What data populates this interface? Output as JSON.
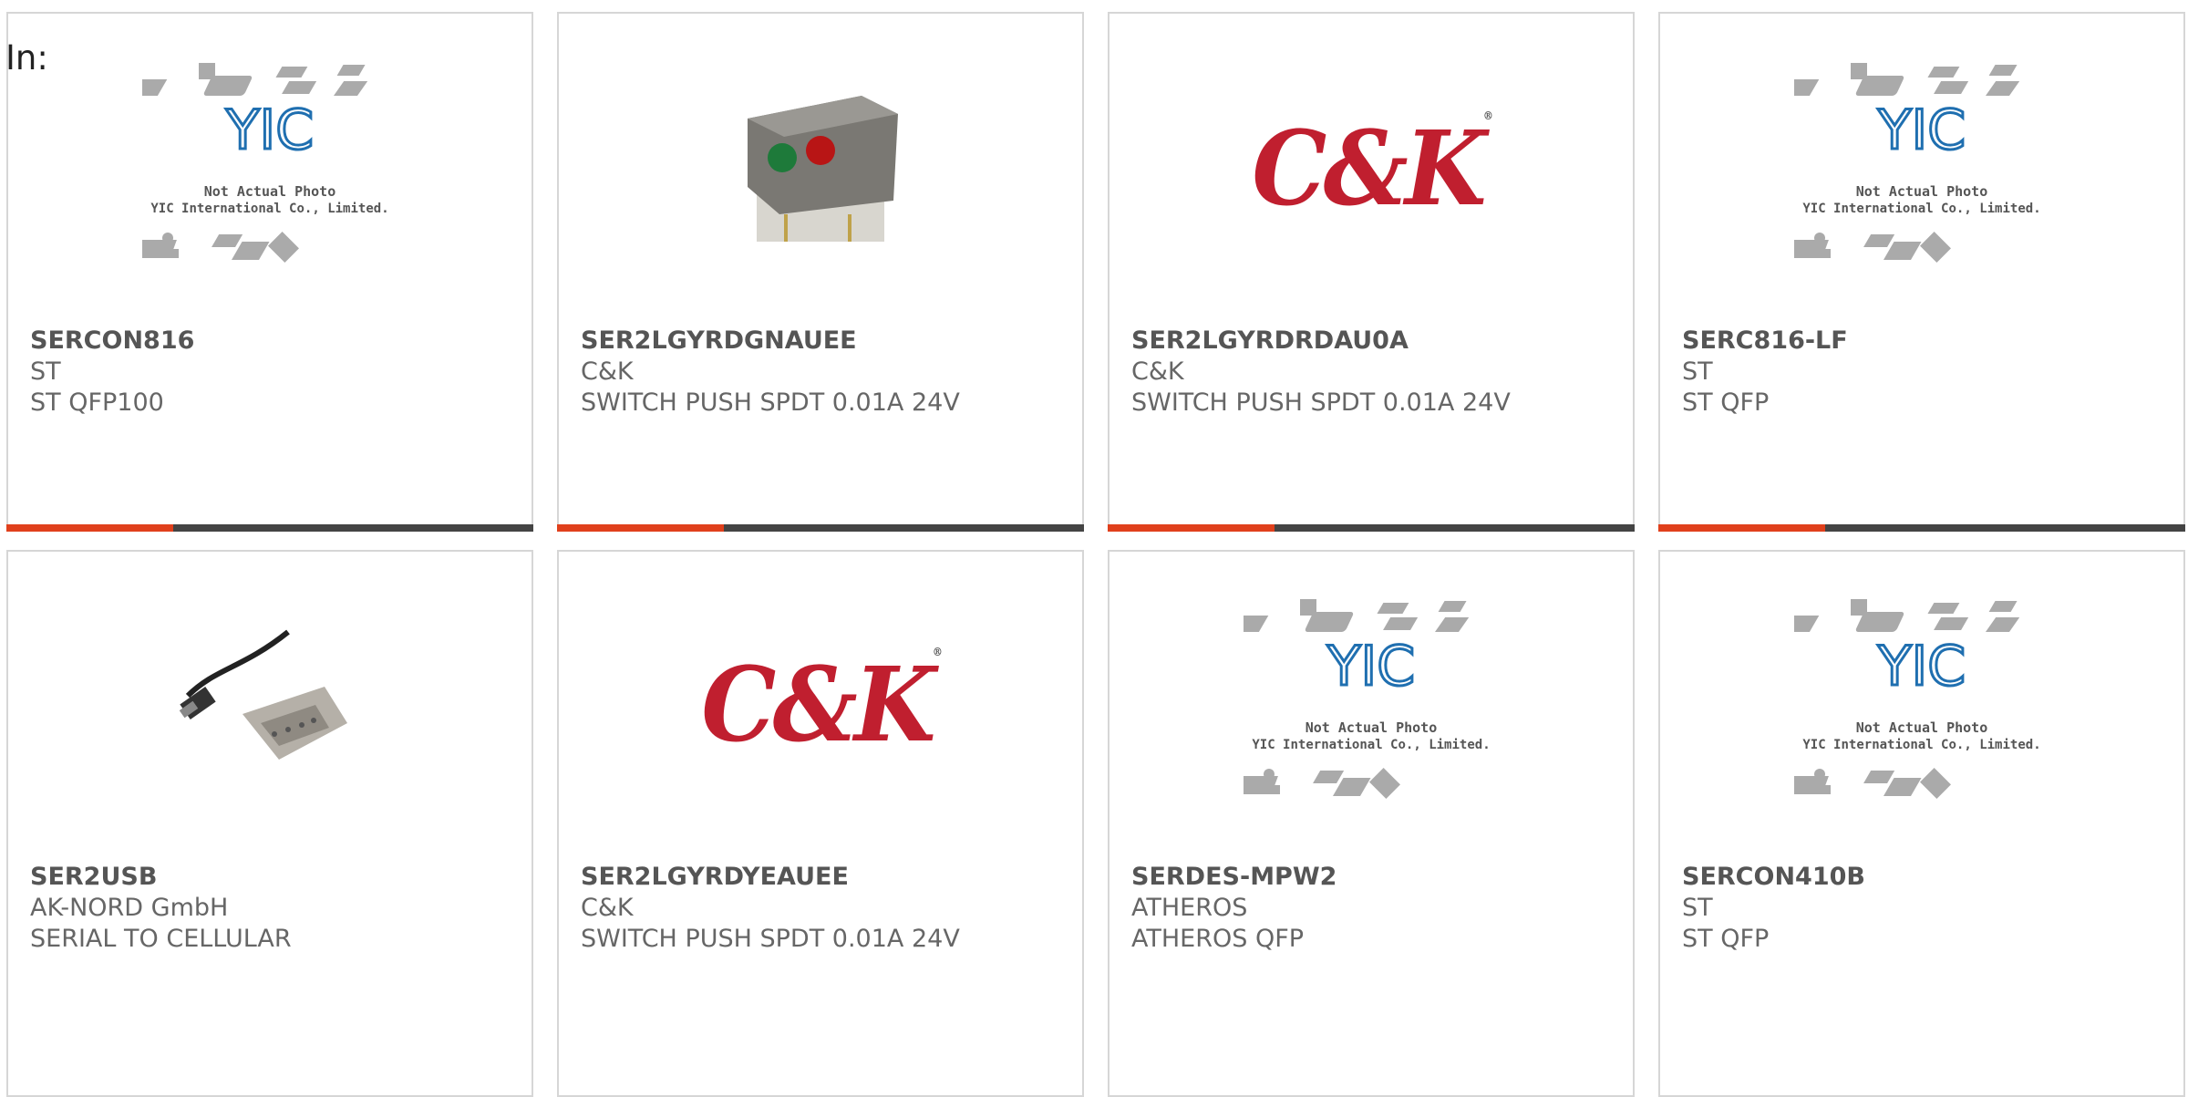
{
  "header": {
    "in_label": "In:"
  },
  "cards": [
    {
      "part": "SERCON816",
      "manufacturer": "ST",
      "description": "ST QFP100",
      "image": "yic-placeholder",
      "placeholder_text_1": "Not Actual Photo",
      "placeholder_text_2": "YIC International Co., Limited.",
      "logo_text": "YIC"
    },
    {
      "part": "SER2LGYRDGNAUEE",
      "manufacturer": "C&K",
      "description": "SWITCH PUSH SPDT 0.01A 24V",
      "image": "switch-photo"
    },
    {
      "part": "SER2LGYRDRDAU0A",
      "manufacturer": "C&K",
      "description": "SWITCH PUSH SPDT 0.01A 24V",
      "image": "ck-logo",
      "logo_text": "C&K"
    },
    {
      "part": "SERC816-LF",
      "manufacturer": "ST",
      "description": "ST QFP",
      "image": "yic-placeholder",
      "placeholder_text_1": "Not Actual Photo",
      "placeholder_text_2": "YIC International Co., Limited.",
      "logo_text": "YIC"
    },
    {
      "part": "SER2USB",
      "manufacturer": "AK-NORD GmbH",
      "description": "SERIAL TO CELLULAR",
      "image": "usb-serial-cable-photo"
    },
    {
      "part": "SER2LGYRDYEAUEE",
      "manufacturer": "C&K",
      "description": "SWITCH PUSH SPDT 0.01A 24V",
      "image": "ck-logo",
      "logo_text": "C&K"
    },
    {
      "part": "SERDES-MPW2",
      "manufacturer": "ATHEROS",
      "description": "ATHEROS QFP",
      "image": "yic-placeholder",
      "placeholder_text_1": "Not Actual Photo",
      "placeholder_text_2": "YIC International Co., Limited.",
      "logo_text": "YIC"
    },
    {
      "part": "SERCON410B",
      "manufacturer": "ST",
      "description": "ST QFP",
      "image": "yic-placeholder",
      "placeholder_text_1": "Not Actual Photo",
      "placeholder_text_2": "YIC International Co., Limited.",
      "logo_text": "YIC"
    }
  ],
  "colors": {
    "accent": "#e0401c",
    "bar": "#444444",
    "ck_red": "#c01f2f",
    "yic_blue": "#1f6fb0"
  }
}
